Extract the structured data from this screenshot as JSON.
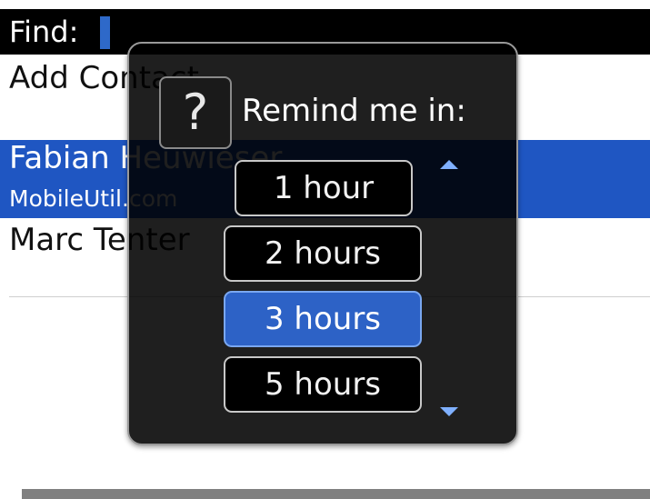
{
  "find": {
    "label": "Find:"
  },
  "list": {
    "add_contact": "Add Contact",
    "selected_name": "Fabian Heuwieser",
    "selected_sub": "MobileUtil.com",
    "third_name": "Marc Tenter"
  },
  "dialog": {
    "icon": "question-icon",
    "icon_glyph": "?",
    "prompt": "Remind me in:",
    "options": [
      "1 hour",
      "2 hours",
      "3 hours",
      "5 hours"
    ],
    "selected_index": 2
  },
  "colors": {
    "selection_blue": "#1f56c2",
    "option_selected": "#2d62c6",
    "dialog_bg": "#000000"
  }
}
